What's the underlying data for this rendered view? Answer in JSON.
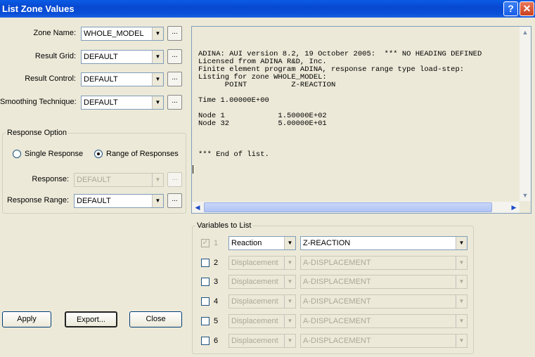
{
  "window": {
    "title": "List Zone Values",
    "help_glyph": "?",
    "close_glyph": "✕"
  },
  "fields": {
    "zone_name": {
      "label": "Zone Name:",
      "value": "WHOLE_MODEL"
    },
    "result_grid": {
      "label": "Result Grid:",
      "value": "DEFAULT"
    },
    "result_control": {
      "label": "Result Control:",
      "value": "DEFAULT"
    },
    "smoothing": {
      "label": "Smoothing Technique:",
      "value": "DEFAULT"
    }
  },
  "response_option": {
    "title": "Response Option",
    "single_label": "Single Response",
    "range_label": "Range of Responses",
    "selected": "range",
    "response_label": "Response:",
    "response_value": "DEFAULT",
    "range_label2": "Response Range:",
    "range_value": "DEFAULT"
  },
  "output": {
    "text": "ADINA: AUI version 8.2, 19 October 2005:  *** NO HEADING DEFINED\nLicensed from ADINA R&D, Inc.\nFinite element program ADINA, response range type load-step:\nListing for zone WHOLE_MODEL:\n      POINT          Z-REACTION\n\nTime 1.00000E+00\n\nNode 1            1.50000E+02\nNode 32           5.00000E+01\n\n\n\n*** End of list."
  },
  "variables": {
    "title": "Variables to List",
    "rows": [
      {
        "num": "1",
        "checked": true,
        "enabled": false,
        "type": "Reaction",
        "var": "Z-REACTION"
      },
      {
        "num": "2",
        "checked": false,
        "enabled": true,
        "type": "Displacement",
        "var": "A-DISPLACEMENT"
      },
      {
        "num": "3",
        "checked": false,
        "enabled": true,
        "type": "Displacement",
        "var": "A-DISPLACEMENT"
      },
      {
        "num": "4",
        "checked": false,
        "enabled": true,
        "type": "Displacement",
        "var": "A-DISPLACEMENT"
      },
      {
        "num": "5",
        "checked": false,
        "enabled": true,
        "type": "Displacement",
        "var": "A-DISPLACEMENT"
      },
      {
        "num": "6",
        "checked": false,
        "enabled": true,
        "type": "Displacement",
        "var": "A-DISPLACEMENT"
      }
    ]
  },
  "buttons": {
    "apply": "Apply",
    "export": "Export...",
    "close": "Close",
    "dots": "..."
  }
}
